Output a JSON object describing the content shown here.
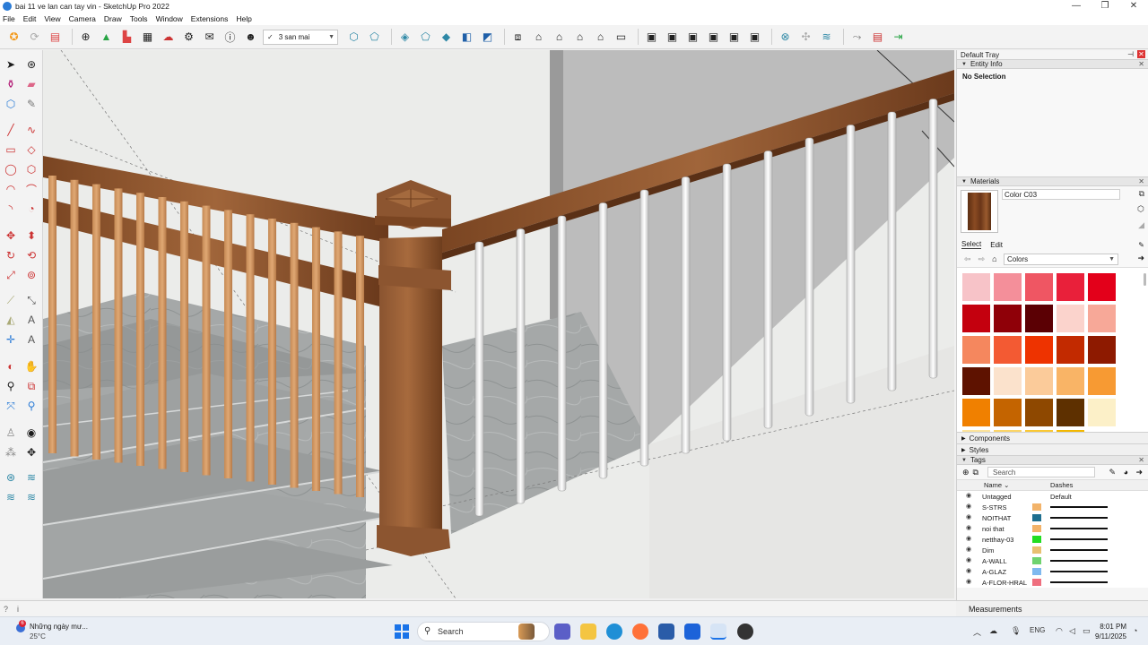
{
  "window": {
    "title": "bai 11 ve lan can tay vin - SketchUp Pro 2022",
    "controls": [
      "—",
      "❐",
      "✕"
    ]
  },
  "menu": [
    "File",
    "Edit",
    "View",
    "Camera",
    "Draw",
    "Tools",
    "Window",
    "Extensions",
    "Help"
  ],
  "toolbar": {
    "scene_label": "3 san mai"
  },
  "tray": {
    "title": "Default Tray",
    "entity_info": {
      "header": "Entity Info",
      "selection": "No Selection"
    },
    "materials": {
      "header": "Materials",
      "name": "Color C03",
      "tabs": [
        "Select",
        "Edit"
      ],
      "library": "Colors",
      "swatches": [
        "#f7c3c8",
        "#f48f9a",
        "#ef5663",
        "#e9203a",
        "#e3001a",
        "#c4000e",
        "#8f0008",
        "#5b0004",
        "#fbd3cc",
        "#f7a898",
        "#f5875e",
        "#f35a33",
        "#ee3300",
        "#c22a00",
        "#8e1a00",
        "#5e1200",
        "#fbe2cc",
        "#fbcb9a",
        "#f9b466",
        "#f79a33",
        "#f08000",
        "#c46400",
        "#8e4800",
        "#5e3000",
        "#fcf0c8",
        "#fde39a",
        "#fcd566",
        "#fac833",
        "#f3b800"
      ]
    },
    "components_label": "Components",
    "styles_label": "Styles",
    "tags": {
      "header": "Tags",
      "search_placeholder": "Search",
      "col_name": "Name",
      "col_dashes": "Dashes",
      "rows": [
        {
          "name": "Untagged",
          "color": "",
          "dashes": "Default"
        },
        {
          "name": "S-STRS",
          "color": "#f2b36a",
          "dashes": ""
        },
        {
          "name": "NOITHAT",
          "color": "#1f6f8f",
          "dashes": ""
        },
        {
          "name": "noi that",
          "color": "#f2b36a",
          "dashes": ""
        },
        {
          "name": "netthay-03",
          "color": "#22dd22",
          "dashes": ""
        },
        {
          "name": "Dim",
          "color": "#e8c070",
          "dashes": ""
        },
        {
          "name": "A-WALL",
          "color": "#6fd36f",
          "dashes": ""
        },
        {
          "name": "A-GLAZ",
          "color": "#7fb9ef",
          "dashes": ""
        },
        {
          "name": "A-FLOR-HRAL",
          "color": "#ef6f7f",
          "dashes": ""
        }
      ]
    }
  },
  "measurements_label": "Measurements",
  "status": {
    "icons": [
      "?",
      "i"
    ]
  },
  "taskbar": {
    "weather_title": "Những ngày mư...",
    "weather_temp": "25°C",
    "weather_badge": "6",
    "search_label": "Search",
    "lang": "ENG",
    "time": "8:01 PM",
    "date": "9/11/2025"
  }
}
